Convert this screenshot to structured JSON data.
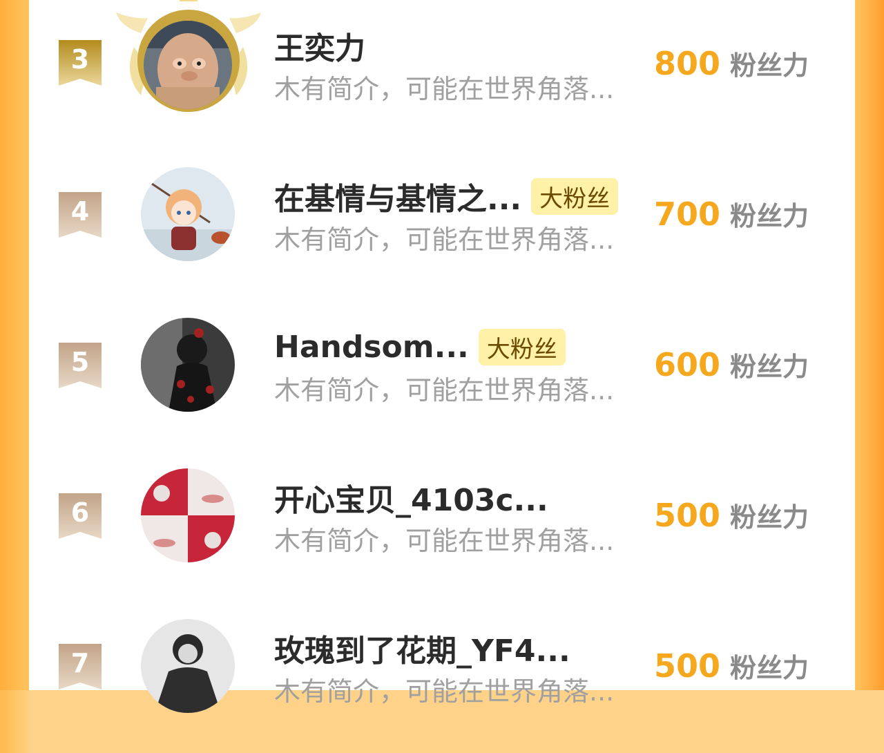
{
  "leaderboard": {
    "score_unit": "粉丝力",
    "rows": [
      {
        "rank": "3",
        "name": "王奕力",
        "badge": "",
        "description": "木有简介，可能在世界角落...",
        "score": "800",
        "avatar_icon": "avatar-plush-costume"
      },
      {
        "rank": "4",
        "name": "在基情与基情之...",
        "badge": "大粉丝",
        "description": "木有简介，可能在世界角落...",
        "score": "700",
        "avatar_icon": "avatar-anime-fishing"
      },
      {
        "rank": "5",
        "name": "Handsom...",
        "badge": "大粉丝",
        "description": "木有简介，可能在世界角落...",
        "score": "600",
        "avatar_icon": "avatar-dark-character"
      },
      {
        "rank": "6",
        "name": "开心宝贝_4103c...",
        "badge": "",
        "description": "木有简介，可能在世界角落...",
        "score": "500",
        "avatar_icon": "avatar-collage-lips"
      },
      {
        "rank": "7",
        "name": "玫瑰到了花期_YF4...",
        "badge": "",
        "description": "木有简介，可能在世界角落...",
        "score": "500",
        "avatar_icon": "avatar-ink-portrait"
      }
    ]
  },
  "colors": {
    "score": "#f5a81e",
    "badge_bg": "#fff1a8",
    "rank3_ribbon": "#c9a640",
    "rank_ribbon": "#cdb39a",
    "side_gradient": "#ffb84d"
  }
}
